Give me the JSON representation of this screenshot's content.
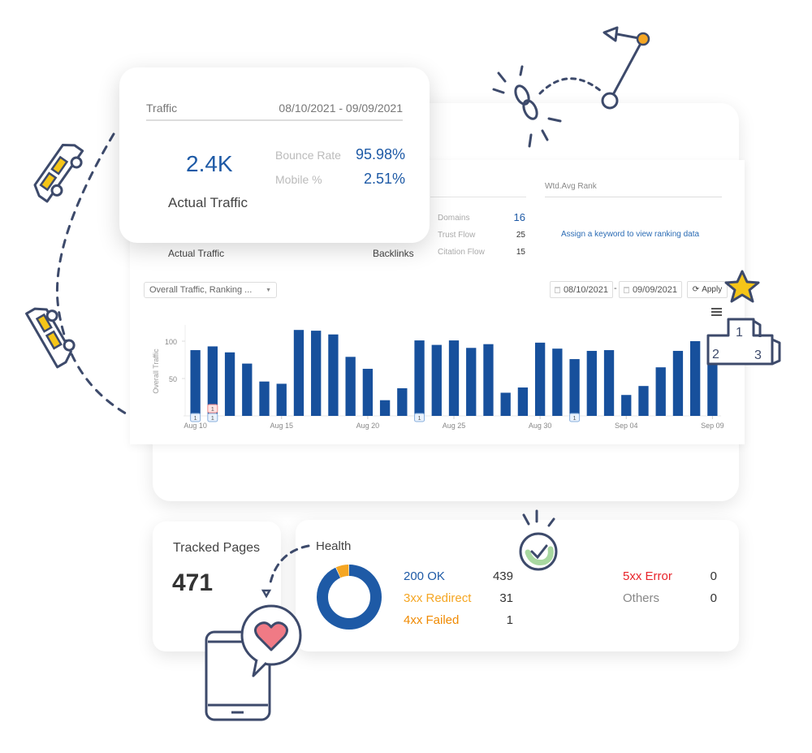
{
  "traffic_card": {
    "title": "Traffic",
    "date_range": "08/10/2021 - 09/09/2021",
    "actual_traffic_value": "2.4K",
    "actual_traffic_label": "Actual Traffic",
    "bounce_rate_label": "Bounce Rate",
    "bounce_rate_value": "95.98%",
    "mobile_label": "Mobile %",
    "mobile_value": "2.51%"
  },
  "overview_panel": {
    "actual_traffic_label": "Actual Traffic",
    "backlinks_label": "Backlinks",
    "backlink_stats": [
      {
        "label": "Domains",
        "value": "16"
      },
      {
        "label": "Trust Flow",
        "value": "25"
      },
      {
        "label": "Citation Flow",
        "value": "15"
      }
    ],
    "rank_title": "Wtd.Avg Rank",
    "rank_link": "Assign a keyword to view ranking data"
  },
  "controls": {
    "metric_select": "Overall Traffic, Ranking ...",
    "start_date": "08/10/2021",
    "date_separator": "-",
    "end_date": "09/09/2021",
    "apply_label": "Apply"
  },
  "chart_data": {
    "type": "bar",
    "title": "",
    "xlabel": "",
    "ylabel": "Overall Traffic",
    "ylim": [
      0,
      120
    ],
    "yticks": [
      50,
      100
    ],
    "grid": false,
    "color": "#17509c",
    "categories": [
      "Aug 10",
      "Aug 11",
      "Aug 12",
      "Aug 13",
      "Aug 14",
      "Aug 15",
      "Aug 16",
      "Aug 17",
      "Aug 18",
      "Aug 19",
      "Aug 20",
      "Aug 21",
      "Aug 22",
      "Aug 23",
      "Aug 24",
      "Aug 25",
      "Aug 26",
      "Aug 27",
      "Aug 28",
      "Aug 29",
      "Aug 30",
      "Aug 31",
      "Sep 01",
      "Sep 02",
      "Sep 03",
      "Sep 04",
      "Sep 05",
      "Sep 06",
      "Sep 07",
      "Sep 08",
      "Sep 09"
    ],
    "values": [
      88,
      93,
      85,
      70,
      46,
      43,
      115,
      114,
      109,
      79,
      63,
      21,
      37,
      101,
      95,
      101,
      91,
      96,
      31,
      38,
      98,
      90,
      76,
      87,
      88,
      28,
      40,
      65,
      87,
      100,
      100
    ],
    "xtick_labels": [
      "Aug 10",
      "Aug 15",
      "Aug 20",
      "Aug 25",
      "Aug 30",
      "Sep 04",
      "Sep 09"
    ],
    "xtick_indices": [
      0,
      5,
      10,
      15,
      20,
      25,
      30
    ],
    "annotations": [
      {
        "index": 0,
        "text": "1",
        "kind": "blue"
      },
      {
        "index": 1,
        "text": "1",
        "kind": "blue"
      },
      {
        "index": 1,
        "text": "1",
        "kind": "red"
      },
      {
        "index": 13,
        "text": "1",
        "kind": "blue"
      },
      {
        "index": 22,
        "text": "1",
        "kind": "blue"
      }
    ]
  },
  "tracked_pages": {
    "title": "Tracked Pages",
    "value": "471"
  },
  "health": {
    "title": "Health",
    "items": [
      {
        "label": "200 OK",
        "value": "439",
        "color": "#1e5aa6"
      },
      {
        "label": "3xx Redirect",
        "value": "31",
        "color": "#f5a623"
      },
      {
        "label": "4xx Failed",
        "value": "1",
        "color": "#f08a00"
      },
      {
        "label": "5xx Error",
        "value": "0",
        "color": "#e8232a"
      },
      {
        "label": "Others",
        "value": "0",
        "color": "#888888"
      }
    ],
    "donut": {
      "ok": 439,
      "redirect": 31,
      "failed": 1
    }
  },
  "colors": {
    "brand_blue": "#1e5aa6",
    "bar_blue": "#17509c",
    "illustration_stroke": "#3d4a6b",
    "accent_yellow": "#f5c518"
  }
}
